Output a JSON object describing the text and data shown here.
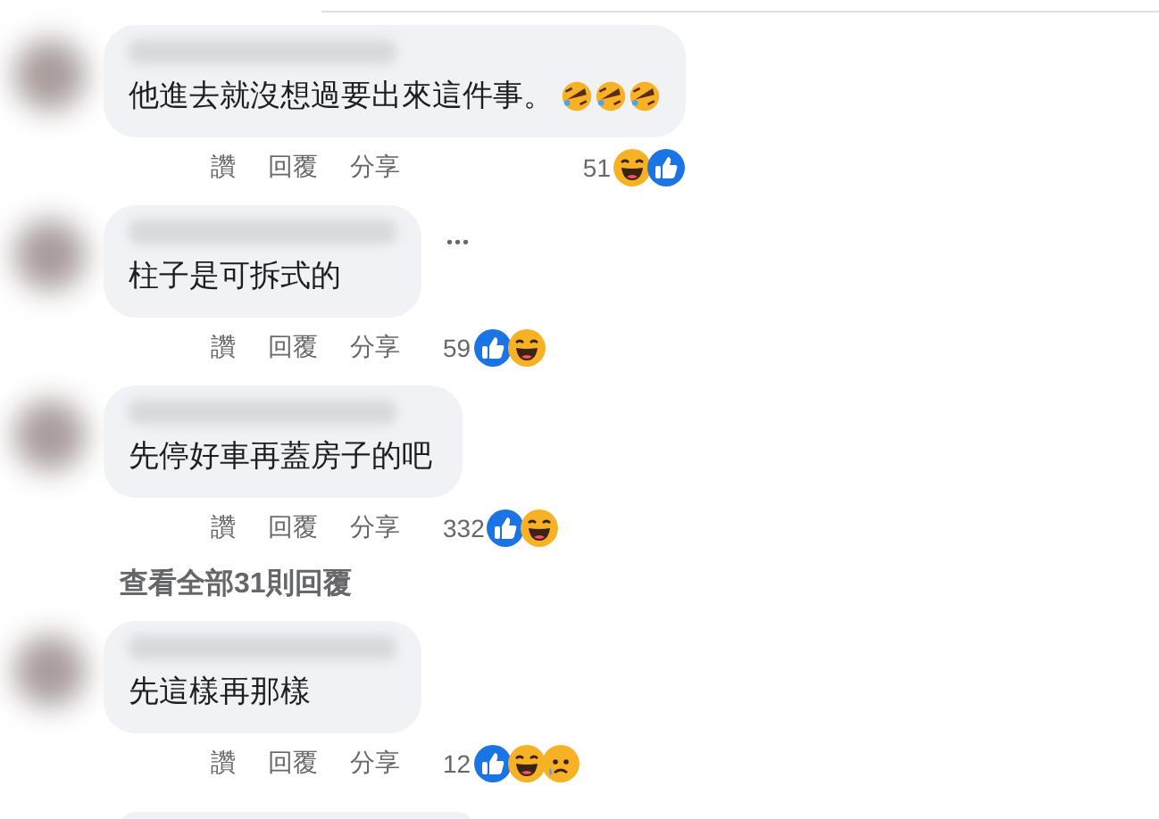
{
  "comments": [
    {
      "text": "他進去就沒想過要出來這件事。",
      "emojis": [
        {
          "kind": "rofl"
        },
        {
          "kind": "rofl"
        },
        {
          "kind": "rofl"
        }
      ],
      "more_menu": false,
      "actions": [
        "讚",
        "回覆",
        "分享"
      ],
      "reaction_count": "51",
      "reactions": [
        {
          "kind": "haha"
        },
        {
          "kind": "like"
        }
      ]
    },
    {
      "text": "柱子是可拆式的",
      "more_menu": true,
      "more_label": "•••",
      "actions": [
        "讚",
        "回覆",
        "分享"
      ],
      "reaction_count": "59",
      "reactions": [
        {
          "kind": "like"
        },
        {
          "kind": "haha"
        }
      ]
    },
    {
      "text": "先停好車再蓋房子的吧",
      "more_menu": false,
      "actions": [
        "讚",
        "回覆",
        "分享"
      ],
      "reaction_count": "332",
      "reactions": [
        {
          "kind": "like"
        },
        {
          "kind": "haha"
        }
      ],
      "view_replies": "查看全部31則回覆"
    },
    {
      "text": "先這樣再那樣",
      "more_menu": false,
      "actions": [
        "讚",
        "回覆",
        "分享"
      ],
      "reaction_count": "12",
      "reactions": [
        {
          "kind": "like"
        },
        {
          "kind": "haha"
        },
        {
          "kind": "sad"
        }
      ]
    }
  ]
}
